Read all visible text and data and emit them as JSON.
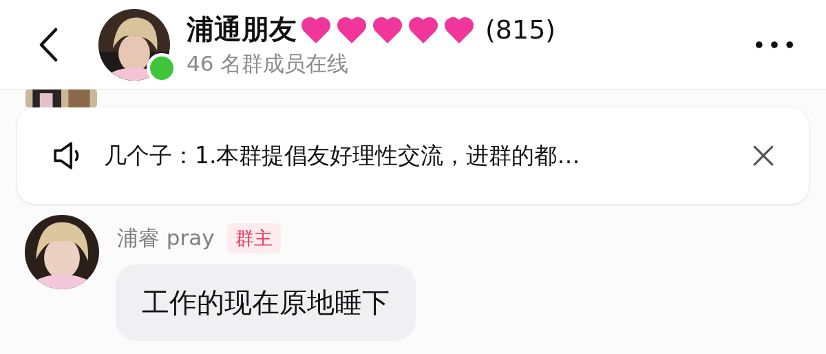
{
  "header": {
    "title": "浦通朋友",
    "member_count": "(815)",
    "online_text": "46 名群成员在线",
    "online": true
  },
  "announcement": {
    "text": "几个子：1.本群提倡友好理性交流，进群的都…"
  },
  "messages": [
    {
      "sender": "浦睿 pray",
      "badge": "群主",
      "text": "工作的现在原地睡下"
    }
  ]
}
